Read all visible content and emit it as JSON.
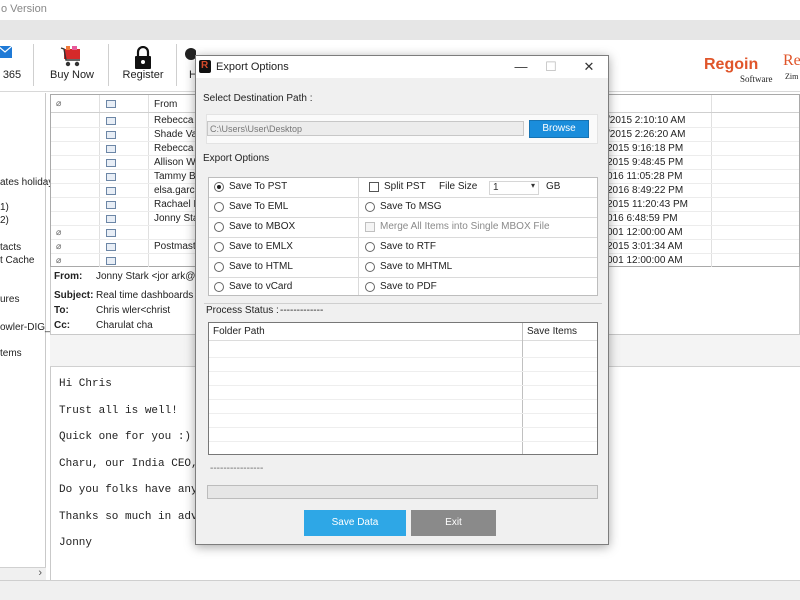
{
  "app": {
    "title": "o Version"
  },
  "toolbar": {
    "items": [
      {
        "label": "365",
        "icon": "mail-icon"
      },
      {
        "label": "Buy Now",
        "icon": "cart-icon"
      },
      {
        "label": "Register",
        "icon": "lock-icon"
      },
      {
        "label": "H",
        "icon": "cloud-icon"
      }
    ],
    "brand_primary": "Regoin",
    "brand_secondary": "Software",
    "brand2_primary": "Re",
    "brand2_secondary": "Zim"
  },
  "left_tree": {
    "items": [
      "ates holiday",
      "1)",
      "2)",
      "tacts",
      "t Cache",
      "ures",
      "owler-DIG_",
      "tems"
    ]
  },
  "mail_grid": {
    "from_header": "From",
    "rows": [
      {
        "from": "Rebecca S",
        "date": "/2015 2:10:10 AM",
        "attachment": false
      },
      {
        "from": "Shade Vau",
        "date": "/2015 2:26:20 AM",
        "attachment": false
      },
      {
        "from": "Rebecca S",
        "date": "2015 9:16:18 PM",
        "attachment": false
      },
      {
        "from": "Allison Wo",
        "date": "2015 9:48:45 PM",
        "attachment": false
      },
      {
        "from": "Tammy Bo",
        "date": "016 11:05:28 PM",
        "attachment": false
      },
      {
        "from": "elsa.garcia",
        "date": "2016 8:49:22 PM",
        "attachment": false
      },
      {
        "from": "Rachael La",
        "date": "2015 11:20:43 PM",
        "attachment": false
      },
      {
        "from": "Jonny Stark",
        "date": "016 6:48:59 PM",
        "attachment": false
      },
      {
        "from": "",
        "date": "001 12:00:00 AM",
        "attachment": true
      },
      {
        "from": "Postmaster",
        "date": "2015 3:01:34 AM",
        "attachment": true
      },
      {
        "from": "",
        "date": "001 12:00:00 AM",
        "attachment": true
      }
    ]
  },
  "mail_header": {
    "from_label": "From:",
    "from_value": "Jonny Stark <jor          ark@",
    "subject_label": "Subject:",
    "subject_value": "Real time dashboards",
    "to_label": "To:",
    "to_value": "Chris          wler<christ",
    "cc_label": "Cc:",
    "cc_value": "Charulat           cha"
  },
  "mail_body": {
    "lines": [
      "Hi Chris",
      "Trust all is well!",
      "Quick one for you :)",
      "Charu, our India CEO,",
      "Do you folks have any",
      "Thanks so much in adv",
      "Jonny"
    ]
  },
  "dialog": {
    "title": "Export Options",
    "dest_label": "Select Destination Path :",
    "path_value": "C:\\Users\\User\\Desktop",
    "browse_label": "Browse",
    "options_label": "Export Options",
    "left_options": [
      "Save To PST",
      "Save To EML",
      "Save to MBOX",
      "Save to EMLX",
      "Save to HTML",
      "Save to vCard"
    ],
    "right_options": [
      "Split PST",
      "Save To MSG",
      "Merge All Items into Single MBOX File",
      "Save to RTF",
      "Save to MHTML",
      "Save to PDF"
    ],
    "file_size_label": "File Size",
    "file_size_value": "1",
    "file_size_unit": "GB",
    "process_label": "Process Status :",
    "process_value": "-------------",
    "col_folder": "Folder Path",
    "col_items": "Save Items",
    "status_dashes": "----------------",
    "progress_fraction": 0,
    "save_label": "Save Data",
    "exit_label": "Exit"
  }
}
